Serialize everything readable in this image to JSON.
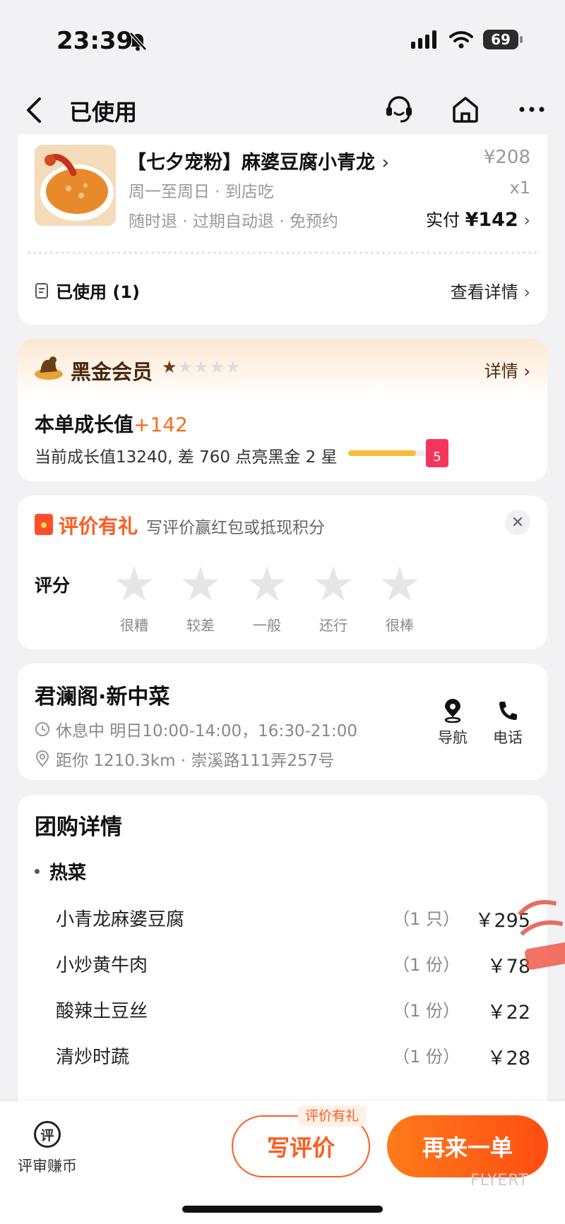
{
  "status_bar": {
    "time": "23:39",
    "battery": "69"
  },
  "nav": {
    "title": "已使用"
  },
  "product": {
    "title": "【七夕宠粉】麻婆豆腐小青龙",
    "original_price": "¥208",
    "schedule": "周一至周日 · 到店吃",
    "quantity": "x1",
    "policies": "随时退 · 过期自动退 · 免预约",
    "paid_label": "实付",
    "paid_amount": "¥142",
    "used_label": "已使用 (1)",
    "detail_link": "查看详情"
  },
  "membership": {
    "title": "黑金会员",
    "stars_on": 1,
    "stars_total": 5,
    "detail_link": "详情",
    "growth_label": "本单成长值",
    "growth_value": "+142",
    "progress_text": "当前成长值13240, 差 760 点亮黑金 2 星",
    "progress_fraction": 0.8,
    "envelope_amount": "5"
  },
  "review": {
    "title": "评价有礼",
    "subtitle": "写评价赢红包或抵现积分",
    "rating_label": "评分",
    "levels": [
      "很糟",
      "较差",
      "一般",
      "还行",
      "很棒"
    ]
  },
  "shop": {
    "name": "君澜阁·新中菜",
    "hours": "休息中 明日10:00-14:00，16:30-21:00",
    "location": "距你 1210.3km · 崇溪路111弄257号",
    "nav_label": "导航",
    "phone_label": "电话"
  },
  "group_detail": {
    "title": "团购详情",
    "category": "热菜",
    "items": [
      {
        "name": "小青龙麻婆豆腐",
        "qty": "（1 只）",
        "price": "￥295"
      },
      {
        "name": "小炒黄牛肉",
        "qty": "（1 份）",
        "price": "￥78"
      },
      {
        "name": "酸辣土豆丝",
        "qty": "（1 份）",
        "price": "￥22"
      },
      {
        "name": "清炒时蔬",
        "qty": "（1 份）",
        "price": "￥28"
      }
    ]
  },
  "bottom_bar": {
    "earn_icon_char": "评",
    "earn_label": "评审赚币",
    "review_badge": "评价有礼",
    "review_button": "写评价",
    "reorder_button": "再来一单"
  },
  "colors": {
    "accent": "#ff5a1f",
    "page_bg": "#f2f2f4",
    "star_gold": "#6a3e16"
  }
}
